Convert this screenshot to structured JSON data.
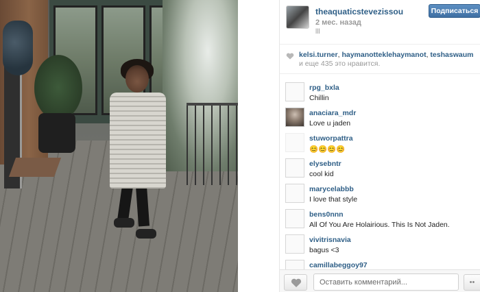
{
  "post": {
    "owner": "theaquaticstevezissou",
    "follow_label": "Подписаться",
    "time_ago": "2 мес. назад",
    "caption": "lll"
  },
  "likes": {
    "user1": "kelsi.turner",
    "user2": "haymanotteklehaymanot",
    "user3": "teshaswaum",
    "rest": "и еще 435 это нравится."
  },
  "comments": [
    {
      "user": "rpg_bxla",
      "text": "Chillin"
    },
    {
      "user": "anaciara_mdr",
      "text": "Love u jaden"
    },
    {
      "user": "stuworpattra",
      "text": "😊😊😊😊"
    },
    {
      "user": "elysebntr",
      "text": "cool kid"
    },
    {
      "user": "marycelabbb",
      "text": "I love that style"
    },
    {
      "user": "bens0nnn",
      "text": "All Of You Are Holairious. This Is Not Jaden."
    },
    {
      "user": "vivitrisnavia",
      "text": "bagus <3"
    },
    {
      "user": "camillabeggoy97",
      "text": ""
    }
  ],
  "footer": {
    "comment_placeholder": "Оставить комментарий...",
    "more_label": "••"
  },
  "colors": {
    "link": "#2e5e86",
    "follow_button": "#3f6fa3",
    "muted": "#999999"
  },
  "icons": {
    "like": "heart-icon",
    "likes_row": "heart-small-icon",
    "more": "ellipsis-icon"
  }
}
